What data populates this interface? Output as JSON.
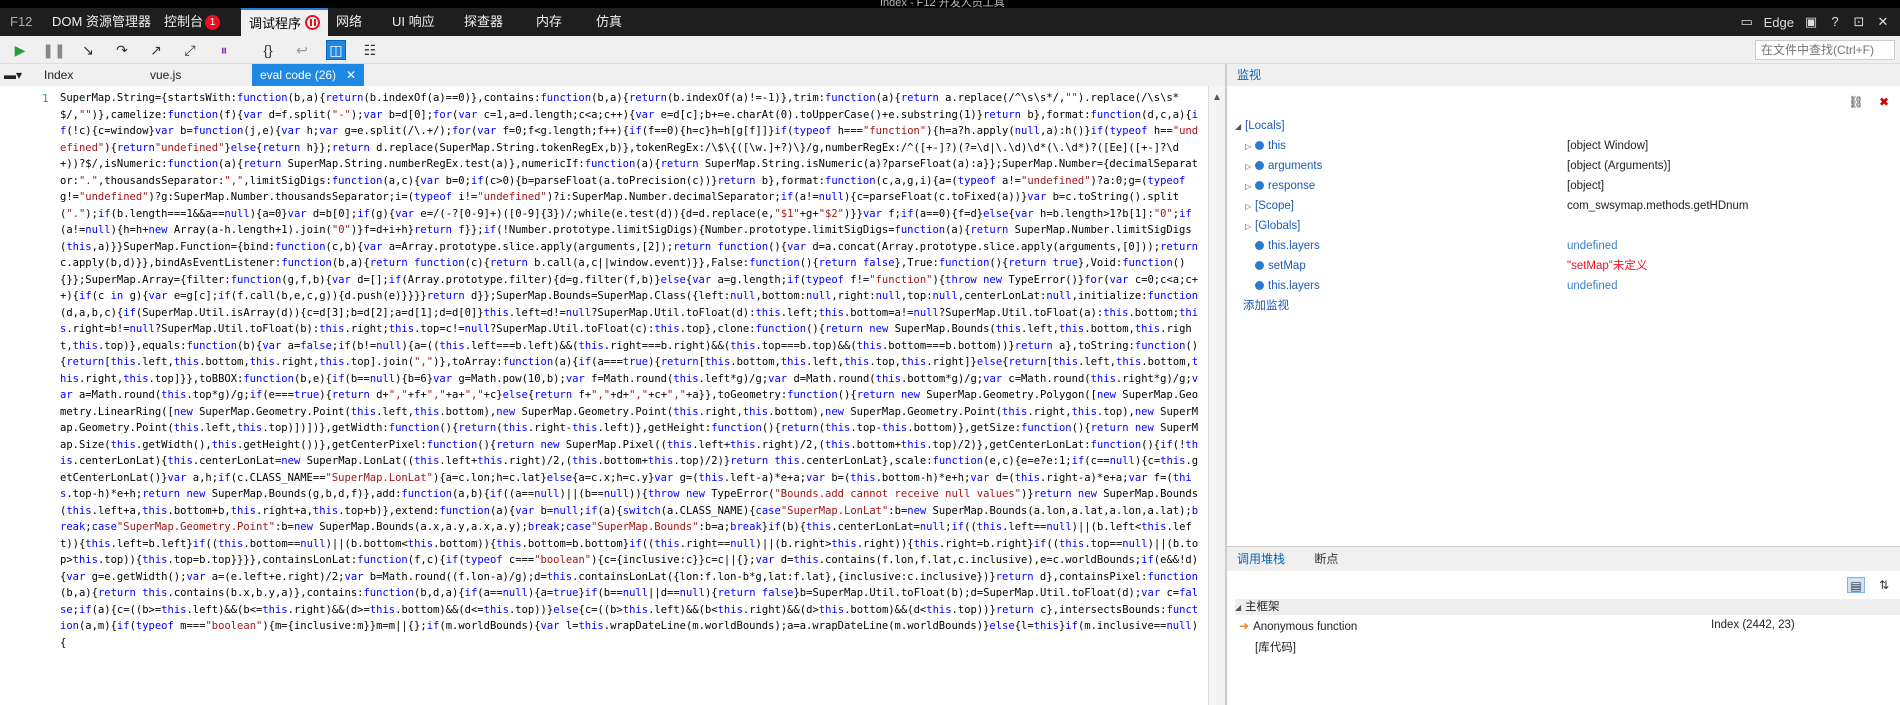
{
  "window": {
    "title": "Index - F12 开发人员工具"
  },
  "top_tabs": [
    {
      "label": "F12"
    },
    {
      "label": "DOM 资源管理器"
    },
    {
      "label": "控制台",
      "badge": "1"
    },
    {
      "label": "调试程序"
    },
    {
      "label": "网络"
    },
    {
      "label": "UI 响应"
    },
    {
      "label": "探查器"
    },
    {
      "label": "内存"
    },
    {
      "label": "仿真"
    }
  ],
  "top_right": {
    "engine": "Edge"
  },
  "search": {
    "placeholder": "在文件中查找(Ctrl+F)"
  },
  "file_tabs": [
    {
      "label": "Index"
    },
    {
      "label": "vue.js"
    },
    {
      "label": "eval code (26)"
    }
  ],
  "editor": {
    "line_number": "1",
    "code": "SuperMap.String={startsWith:function(b,a){return(b.indexOf(a)==0)},contains:function(b,a){return(b.indexOf(a)!=-1)},trim:function(a){return a.replace(/^\\s\\s*/,\"\").replace(/\\s\\s*$/,\"\")},camelize:function(f){var d=f.split(\"-\");var b=d[0];for(var c=1,a=d.length;c<a;c++){var e=d[c];b+=e.charAt(0).toUpperCase()+e.substring(1)}return b},format:function(d,c,a){if(!c){c=window}var b=function(j,e){var h;var g=e.split(/\\.+/);for(var f=0;f<g.length;f++){if(f==0){h=c}h=h[g[f]]}if(typeof h===\"function\"){h=a?h.apply(null,a):h()}if(typeof h==\"undefined\"){return\"undefined\"}else{return h}};return d.replace(SuperMap.String.tokenRegEx,b)},tokenRegEx:/\\$\\{([\\w.]+?)\\}/g,numberRegEx:/^([+-]?)(?=\\d|\\.\\d)\\d*(\\.\\d*)?([Ee]([+-]?\\d+))?$/,isNumeric:function(a){return SuperMap.String.numberRegEx.test(a)},numericIf:function(a){return SuperMap.String.isNumeric(a)?parseFloat(a):a}};SuperMap.Number={decimalSeparator:\".\",thousandsSeparator:\",\",limitSigDigs:function(a,c){var b=0;if(c>0){b=parseFloat(a.toPrecision(c))}return b},format:function(c,a,g,i){a=(typeof a!=\"undefined\")?a:0;g=(typeof g!=\"undefined\")?g:SuperMap.Number.thousandsSeparator;i=(typeof i!=\"undefined\")?i:SuperMap.Number.decimalSeparator;if(a!=null){c=parseFloat(c.toFixed(a))}var b=c.toString().split(\".\");if(b.length===1&&a==null){a=0}var d=b[0];if(g){var e=/(-?[0-9]+)([0-9]{3})/;while(e.test(d)){d=d.replace(e,\"$1\"+g+\"$2\")}}var f;if(a==0){f=d}else{var h=b.length>1?b[1]:\"0\";if(a!=null){h=h+new Array(a-h.length+1).join(\"0\")}f=d+i+h}return f}};if(!Number.prototype.limitSigDigs){Number.prototype.limitSigDigs=function(a){return SuperMap.Number.limitSigDigs(this,a)}}SuperMap.Function={bind:function(c,b){var a=Array.prototype.slice.apply(arguments,[2]);return function(){var d=a.concat(Array.prototype.slice.apply(arguments,[0]));return c.apply(b,d)}},bindAsEventListener:function(b,a){return function(c){return b.call(a,c||window.event)}},False:function(){return false},True:function(){return true},Void:function(){}};SuperMap.Array={filter:function(g,f,b){var d=[];if(Array.prototype.filter){d=g.filter(f,b)}else{var a=g.length;if(typeof f!=\"function\"){throw new TypeError()}for(var c=0;c<a;c++){if(c in g){var e=g[c];if(f.call(b,e,c,g)){d.push(e)}}}}return d}};SuperMap.Bounds=SuperMap.Class({left:null,bottom:null,right:null,top:null,centerLonLat:null,initialize:function(d,a,b,c){if(SuperMap.Util.isArray(d)){c=d[3];b=d[2];a=d[1];d=d[0]}this.left=d!=null?SuperMap.Util.toFloat(d):this.left;this.bottom=a!=null?SuperMap.Util.toFloat(a):this.bottom;this.right=b!=null?SuperMap.Util.toFloat(b):this.right;this.top=c!=null?SuperMap.Util.toFloat(c):this.top},clone:function(){return new SuperMap.Bounds(this.left,this.bottom,this.right,this.top)},equals:function(b){var a=false;if(b!=null){a=((this.left===b.left)&&(this.right===b.right)&&(this.top===b.top)&&(this.bottom===b.bottom))}return a},toString:function(){return[this.left,this.bottom,this.right,this.top].join(\",\")},toArray:function(a){if(a===true){return[this.bottom,this.left,this.top,this.right]}else{return[this.left,this.bottom,this.right,this.top]}},toBBOX:function(b,e){if(b==null){b=6}var g=Math.pow(10,b);var f=Math.round(this.left*g)/g;var d=Math.round(this.bottom*g)/g;var c=Math.round(this.right*g)/g;var a=Math.round(this.top*g)/g;if(e===true){return d+\",\"+f+\",\"+a+\",\"+c}else{return f+\",\"+d+\",\"+c+\",\"+a}},toGeometry:function(){return new SuperMap.Geometry.Polygon([new SuperMap.Geometry.LinearRing([new SuperMap.Geometry.Point(this.left,this.bottom),new SuperMap.Geometry.Point(this.right,this.bottom),new SuperMap.Geometry.Point(this.right,this.top),new SuperMap.Geometry.Point(this.left,this.top)])])},getWidth:function(){return(this.right-this.left)},getHeight:function(){return(this.top-this.bottom)},getSize:function(){return new SuperMap.Size(this.getWidth(),this.getHeight())},getCenterPixel:function(){return new SuperMap.Pixel((this.left+this.right)/2,(this.bottom+this.top)/2)},getCenterLonLat:function(){if(!this.centerLonLat){this.centerLonLat=new SuperMap.LonLat((this.left+this.right)/2,(this.bottom+this.top)/2)}return this.centerLonLat},scale:function(e,c){e=e?e:1;if(c==null){c=this.getCenterLonLat()}var a,h;if(c.CLASS_NAME==\"SuperMap.LonLat\"){a=c.lon;h=c.lat}else{a=c.x;h=c.y}var g=(this.left-a)*e+a;var b=(this.bottom-h)*e+h;var d=(this.right-a)*e+a;var f=(this.top-h)*e+h;return new SuperMap.Bounds(g,b,d,f)},add:function(a,b){if((a==null)||(b==null)){throw new TypeError(\"Bounds.add cannot receive null values\")}return new SuperMap.Bounds(this.left+a,this.bottom+b,this.right+a,this.top+b)},extend:function(a){var b=null;if(a){switch(a.CLASS_NAME){case\"SuperMap.LonLat\":b=new SuperMap.Bounds(a.lon,a.lat,a.lon,a.lat);break;case\"SuperMap.Geometry.Point\":b=new SuperMap.Bounds(a.x,a.y,a.x,a.y);break;case\"SuperMap.Bounds\":b=a;break}if(b){this.centerLonLat=null;if((this.left==null)||(b.left<this.left)){this.left=b.left}if((this.bottom==null)||(b.bottom<this.bottom)){this.bottom=b.bottom}if((this.right==null)||(b.right>this.right)){this.right=b.right}if((this.top==null)||(b.top>this.top)){this.top=b.top}}}},containsLonLat:function(f,c){if(typeof c===\"boolean\"){c={inclusive:c}}c=c||{};var d=this.contains(f.lon,f.lat,c.inclusive),e=c.worldBounds;if(e&&!d){var g=e.getWidth();var a=(e.left+e.right)/2;var b=Math.round((f.lon-a)/g);d=this.containsLonLat({lon:f.lon-b*g,lat:f.lat},{inclusive:c.inclusive})}return d},containsPixel:function(b,a){return this.contains(b.x,b.y,a)},contains:function(b,d,a){if(a==null){a=true}if(b==null||d==null){return false}b=SuperMap.Util.toFloat(b);d=SuperMap.Util.toFloat(d);var c=false;if(a){c=((b>=this.left)&&(b<=this.right)&&(d>=this.bottom)&&(d<=this.top))}else{c=((b>this.left)&&(b<this.right)&&(d>this.bottom)&&(d<this.top))}return c},intersectsBounds:function(a,m){if(typeof m===\"boolean\"){m={inclusive:m}}m=m||{};if(m.worldBounds){var l=this.wrapDateLine(m.worldBounds);a=a.wrapDateLine(m.worldBounds)}else{l=this}if(m.inclusive==null){"
  },
  "watch": {
    "title": "监视",
    "locals_label": "[Locals]",
    "rows": [
      {
        "name": "this",
        "value": "[object Window]"
      },
      {
        "name": "arguments",
        "value": "[object (Arguments)]"
      },
      {
        "name": "response",
        "value": "[object]"
      },
      {
        "name": "[Scope]",
        "value": "com_swsymap.methods.getHDnum"
      },
      {
        "name": "[Globals]",
        "value": ""
      }
    ],
    "watches": [
      {
        "name": "this.layers",
        "value": "undefined"
      },
      {
        "name": "setMap",
        "value": "\"setMap\"未定义"
      },
      {
        "name": "this.layers",
        "value": "undefined"
      }
    ],
    "add_label": "添加监视"
  },
  "callstack": {
    "tab_callstack": "调用堆栈",
    "tab_breakpoints": "断点",
    "frame_header": "主框架",
    "frames": [
      {
        "name": "Anonymous function",
        "location": "Index (2442, 23)"
      },
      {
        "name": "[库代码]",
        "location": ""
      }
    ]
  }
}
